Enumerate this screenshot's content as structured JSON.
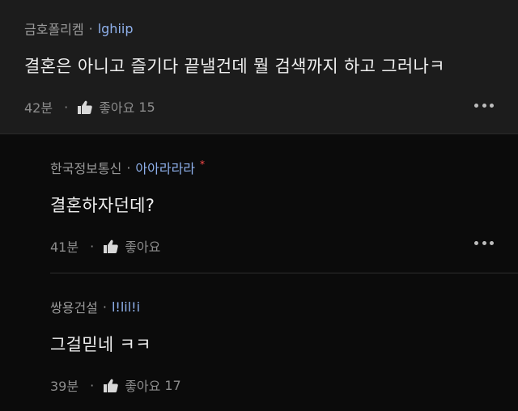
{
  "comments": [
    {
      "author": "금호폴리켐",
      "nickname": "lghiip",
      "text": "결혼은 아니고 즐기다 끝낼건데 뭘 검색까지 하고 그러나ㅋ",
      "time": "42분",
      "like_label": "좋아요",
      "like_count": "15"
    },
    {
      "author": "한국정보통신",
      "nickname": "아아라라라",
      "author_mark": "*",
      "text": "결혼하자던데?",
      "time": "41분",
      "like_label": "좋아요",
      "like_count": ""
    },
    {
      "author": "쌍용건설",
      "nickname": "l!lil!i",
      "text": "그걸믿네 ㅋㅋ",
      "time": "39분",
      "like_label": "좋아요",
      "like_count": "17"
    }
  ],
  "separator": "·",
  "icons": {
    "like": "thumbs-up-icon",
    "more": "more-dots-icon"
  },
  "colors": {
    "nickname": "#8fb1ec",
    "author_mark": "#ff4b4b",
    "main_bg": "#1c1c1c",
    "reply_bg": "#0b0b0b"
  }
}
